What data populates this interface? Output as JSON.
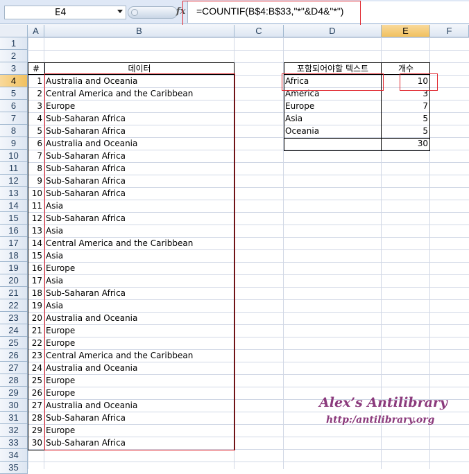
{
  "formula_bar": {
    "name_box": "E4",
    "fx": "fx",
    "formula": "=COUNTIF(B$4:B$33,\"*\"&D4&\"*\")"
  },
  "columns": [
    "A",
    "B",
    "C",
    "D",
    "E",
    "F"
  ],
  "rows": [
    "1",
    "2",
    "3",
    "4",
    "5",
    "6",
    "7",
    "8",
    "9",
    "10",
    "11",
    "12",
    "13",
    "14",
    "15",
    "16",
    "17",
    "18",
    "19",
    "20",
    "21",
    "22",
    "23",
    "24",
    "25",
    "26",
    "27",
    "28",
    "29",
    "30",
    "31",
    "32",
    "33",
    "34",
    "35"
  ],
  "data_table": {
    "headers": {
      "num": "#",
      "data": "데이터"
    },
    "rows": [
      {
        "n": "1",
        "v": "Australia and Oceania"
      },
      {
        "n": "2",
        "v": "Central America and the Caribbean"
      },
      {
        "n": "3",
        "v": "Europe"
      },
      {
        "n": "4",
        "v": "Sub-Saharan Africa"
      },
      {
        "n": "5",
        "v": "Sub-Saharan Africa"
      },
      {
        "n": "6",
        "v": "Australia and Oceania"
      },
      {
        "n": "7",
        "v": "Sub-Saharan Africa"
      },
      {
        "n": "8",
        "v": "Sub-Saharan Africa"
      },
      {
        "n": "9",
        "v": "Sub-Saharan Africa"
      },
      {
        "n": "10",
        "v": "Sub-Saharan Africa"
      },
      {
        "n": "11",
        "v": "Asia"
      },
      {
        "n": "12",
        "v": "Sub-Saharan Africa"
      },
      {
        "n": "13",
        "v": "Asia"
      },
      {
        "n": "14",
        "v": "Central America and the Caribbean"
      },
      {
        "n": "15",
        "v": "Asia"
      },
      {
        "n": "16",
        "v": "Europe"
      },
      {
        "n": "17",
        "v": "Asia"
      },
      {
        "n": "18",
        "v": "Sub-Saharan Africa"
      },
      {
        "n": "19",
        "v": "Asia"
      },
      {
        "n": "20",
        "v": "Australia and Oceania"
      },
      {
        "n": "21",
        "v": "Europe"
      },
      {
        "n": "22",
        "v": "Europe"
      },
      {
        "n": "23",
        "v": "Central America and the Caribbean"
      },
      {
        "n": "24",
        "v": "Australia and Oceania"
      },
      {
        "n": "25",
        "v": "Europe"
      },
      {
        "n": "26",
        "v": "Europe"
      },
      {
        "n": "27",
        "v": "Australia and Oceania"
      },
      {
        "n": "28",
        "v": "Sub-Saharan Africa"
      },
      {
        "n": "29",
        "v": "Europe"
      },
      {
        "n": "30",
        "v": "Sub-Saharan Africa"
      }
    ]
  },
  "count_table": {
    "headers": {
      "text": "포함되어야할 텍스트",
      "count": "개수"
    },
    "rows": [
      {
        "t": "Africa",
        "c": "10"
      },
      {
        "t": "America",
        "c": "3"
      },
      {
        "t": "Europe",
        "c": "7"
      },
      {
        "t": "Asia",
        "c": "5"
      },
      {
        "t": "Oceania",
        "c": "5"
      }
    ],
    "total": "30"
  },
  "watermark": {
    "title": "Alex’s Antilibrary",
    "url": "http:/antilibrary.org"
  }
}
